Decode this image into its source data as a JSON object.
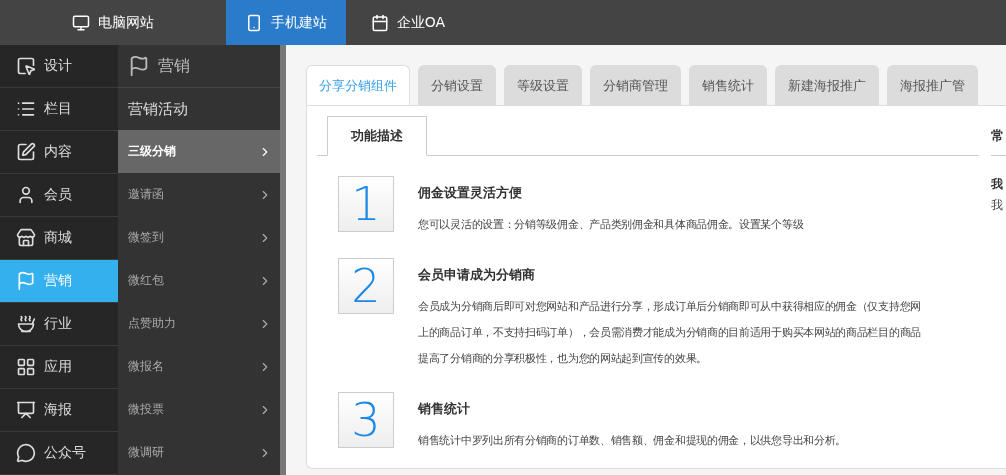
{
  "top_tabs": [
    {
      "label": "电脑网站",
      "selected": false
    },
    {
      "label": "手机建站",
      "selected": true
    },
    {
      "label": "企业OA",
      "selected": false
    }
  ],
  "main_nav": {
    "header": "设计",
    "items": [
      {
        "label": "栏目",
        "selected": false
      },
      {
        "label": "内容",
        "selected": false
      },
      {
        "label": "会员",
        "selected": false
      },
      {
        "label": "商城",
        "selected": false
      },
      {
        "label": "营销",
        "selected": true
      },
      {
        "label": "行业",
        "selected": false
      },
      {
        "label": "应用",
        "selected": false
      },
      {
        "label": "海报",
        "selected": false
      },
      {
        "label": "公众号",
        "selected": false
      }
    ]
  },
  "sub_nav": {
    "title": "营销",
    "group": "营销活动",
    "items": [
      {
        "label": "三级分销",
        "selected": true
      },
      {
        "label": "邀请函",
        "selected": false
      },
      {
        "label": "微签到",
        "selected": false
      },
      {
        "label": "微红包",
        "selected": false
      },
      {
        "label": "点赞助力",
        "selected": false
      },
      {
        "label": "微报名",
        "selected": false
      },
      {
        "label": "微投票",
        "selected": false
      },
      {
        "label": "微调研",
        "selected": false
      }
    ]
  },
  "content_tabs": [
    {
      "label": "分享分销组件",
      "selected": true
    },
    {
      "label": "分销设置",
      "selected": false
    },
    {
      "label": "等级设置",
      "selected": false
    },
    {
      "label": "分销商管理",
      "selected": false
    },
    {
      "label": "销售统计",
      "selected": false
    },
    {
      "label": "新建海报推广",
      "selected": false
    },
    {
      "label": "海报推广管",
      "selected": false
    }
  ],
  "panel_tabs": [
    {
      "label": "功能描述",
      "selected": true
    }
  ],
  "features": [
    {
      "number": "1",
      "title": "佣金设置灵活方便",
      "lines": [
        "您可以灵活的设置：分销等级佣金、产品类别佣金和具体商品佣金。设置某个等级"
      ]
    },
    {
      "number": "2",
      "title": "会员申请成为分销商",
      "lines": [
        "会员成为分销商后即可对您网站和产品进行分享，形成订单后分销商即可从中获得相应的佣金（仅支持您网",
        "上的商品订单，不支持扫码订单），会员需消费才能成为分销商的目前适用于购买本网站的商品栏目的商品",
        "提高了分销商的分享积极性，也为您的网站起到宣传的效果。"
      ]
    },
    {
      "number": "3",
      "title": "销售统计",
      "lines": [
        "销售统计中罗列出所有分销商的订单数、销售额、佣金和提现的佣金，以供您导出和分析。"
      ]
    }
  ],
  "side_panel": {
    "heading": "常",
    "title": "我",
    "text": "我"
  }
}
